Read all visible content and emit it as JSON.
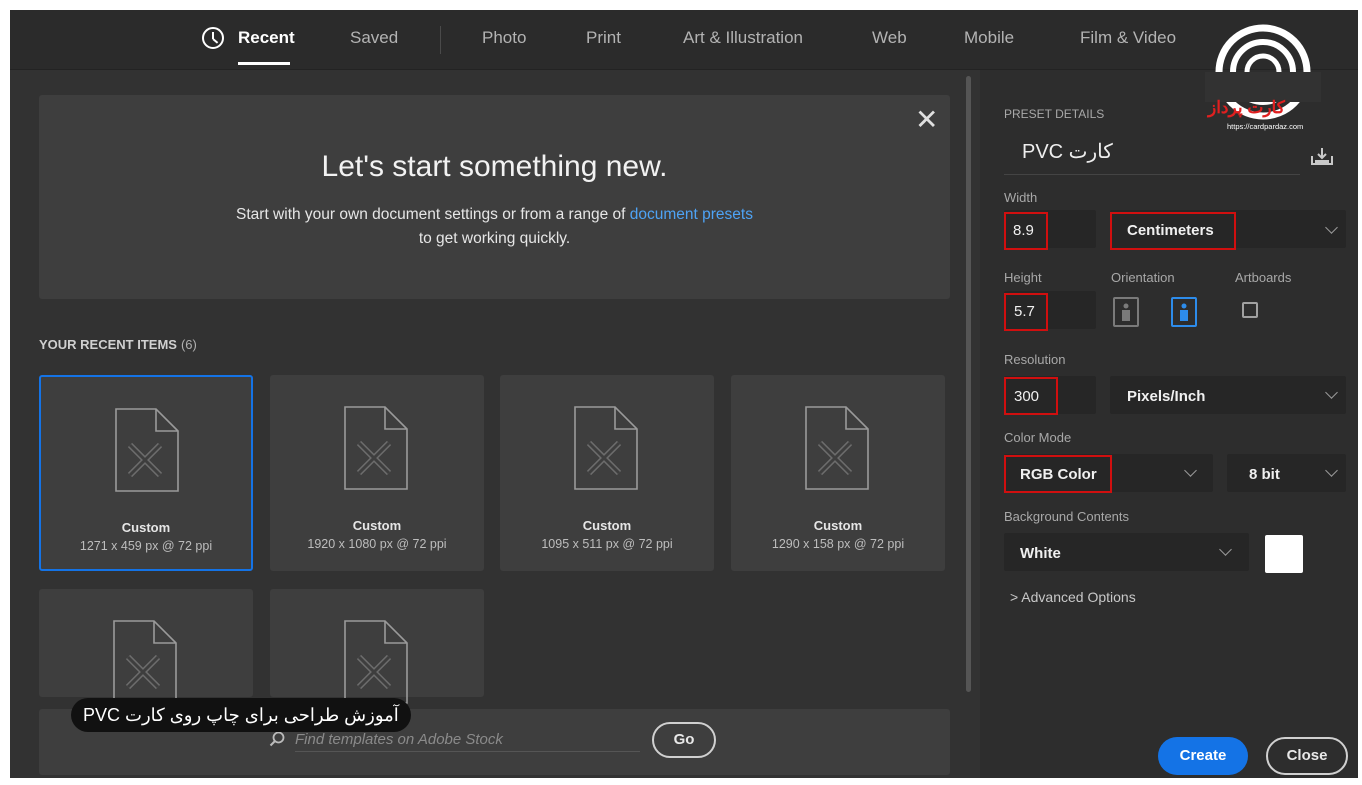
{
  "tabs": {
    "recent": "Recent",
    "saved": "Saved",
    "photo": "Photo",
    "print": "Print",
    "art": "Art & Illustration",
    "web": "Web",
    "mobile": "Mobile",
    "film": "Film & Video"
  },
  "hero": {
    "title": "Let's start something new.",
    "sub_line1_a": "Start with your own document settings or from a range of",
    "sub_link": "document presets",
    "sub_line2": "to get working quickly.",
    "close": "✕"
  },
  "recent": {
    "heading": "YOUR RECENT ITEMS",
    "count": "(6)",
    "items": [
      {
        "name": "Custom",
        "info": "1271 x 459 px @ 72 ppi"
      },
      {
        "name": "Custom",
        "info": "1920 x 1080 px @ 72 ppi"
      },
      {
        "name": "Custom",
        "info": "1095 x 511 px @ 72 ppi"
      },
      {
        "name": "Custom",
        "info": "1290 x 158 px @ 72 ppi"
      }
    ]
  },
  "search": {
    "placeholder": "Find templates on Adobe Stock",
    "go": "Go"
  },
  "caption": "آموزش طراحی برای چاپ روی کارت PVC",
  "preset": {
    "heading": "PRESET DETAILS",
    "name": "کارت PVC",
    "width_label": "Width",
    "width_value": "8.9",
    "unit": "Centimeters",
    "height_label": "Height",
    "height_value": "5.7",
    "orientation_label": "Orientation",
    "artboards_label": "Artboards",
    "resolution_label": "Resolution",
    "resolution_value": "300",
    "resolution_unit": "Pixels/Inch",
    "color_mode_label": "Color Mode",
    "color_mode": "RGB Color",
    "bit_depth": "8 bit",
    "background_label": "Background Contents",
    "background": "White",
    "advanced": "> Advanced Options",
    "create": "Create",
    "close": "Close"
  },
  "logo": {
    "text": "کارت پرداز",
    "url": "https://cardpardaz.com"
  },
  "colors": {
    "accent": "#1473e6",
    "highlight_box": "#d00f0f",
    "panel_bg": "#2d2d2d",
    "app_bg": "#323232"
  }
}
